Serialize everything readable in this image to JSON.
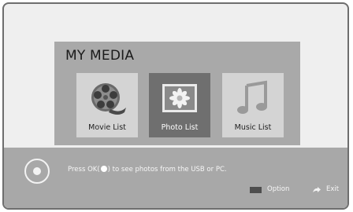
{
  "panel": {
    "title": "MY MEDIA",
    "tiles": [
      {
        "label": "Movie List",
        "icon": "film-reel-icon",
        "selected": false
      },
      {
        "label": "Photo List",
        "icon": "photo-icon",
        "selected": true
      },
      {
        "label": "Music List",
        "icon": "music-note-icon",
        "selected": false
      }
    ]
  },
  "footer": {
    "hint_before": "Press OK(",
    "hint_after": ") to see photos from the USB or PC.",
    "option_label": "Option",
    "exit_label": "Exit"
  },
  "colors": {
    "screen_bg": "#efefef",
    "panel_bg": "#a9a9a9",
    "tile_bg": "#d4d4d4",
    "tile_selected_bg": "#6f6f6f",
    "bar_bg": "#a8a8a8"
  }
}
